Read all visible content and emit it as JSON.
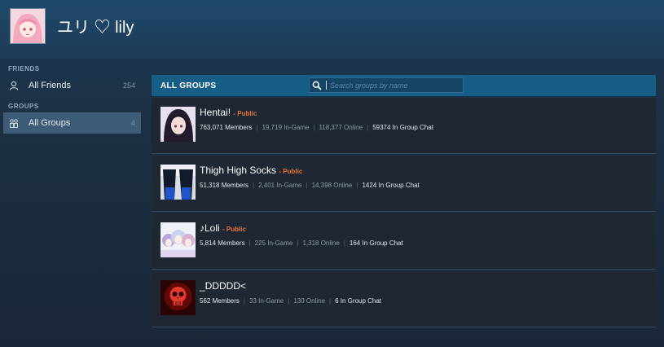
{
  "user": {
    "name": "ユリ ♡ lily"
  },
  "sidebar": {
    "friends_heading": "FRIENDS",
    "friends_label": "All Friends",
    "friends_count": "254",
    "groups_heading": "GROUPS",
    "groups_label": "All Groups",
    "groups_count": "4"
  },
  "main": {
    "title": "ALL GROUPS",
    "search_placeholder": "Search groups by name",
    "groups": [
      {
        "name": "Hentai!",
        "visibility": "- Public",
        "members": "763,071 Members",
        "ingame": "19,719 In-Game",
        "online": "118,377 Online",
        "chat": "59374 In Group Chat"
      },
      {
        "name": "Thigh High Socks",
        "visibility": "- Public",
        "members": "51,318 Members",
        "ingame": "2,401 In-Game",
        "online": "14,398 Online",
        "chat": "1424 In Group Chat"
      },
      {
        "name": "♪Loli",
        "visibility": "- Public",
        "members": "5,814 Members",
        "ingame": "225 In-Game",
        "online": "1,318 Online",
        "chat": "164 In Group Chat"
      },
      {
        "name": "_DDDDD<",
        "visibility": "",
        "members": "562 Members",
        "ingame": "33 In-Game",
        "online": "130 Online",
        "chat": "6 In Group Chat"
      }
    ]
  },
  "colors": {
    "accent": "#165e86",
    "public": "#e8743b",
    "card": "#1f2733"
  }
}
